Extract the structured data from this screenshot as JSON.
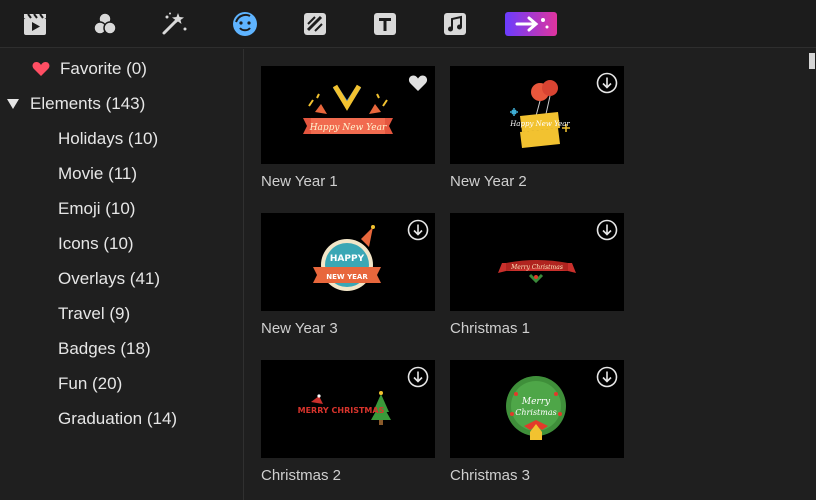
{
  "toolbar": {
    "icons": [
      "media-icon",
      "effects-icon",
      "magic-icon",
      "elements-icon",
      "transitions-icon",
      "text-icon",
      "audio-icon",
      "plugin-icon"
    ],
    "active_color": "#5fb4ff"
  },
  "sidebar": {
    "favorite": {
      "label": "Favorite (0)",
      "icon": "heart-icon",
      "color": "#ff4e63"
    },
    "elements": {
      "label": "Elements (143)",
      "icon": "triangle-down-icon"
    },
    "children": [
      {
        "label": "Holidays (10)"
      },
      {
        "label": "Movie (11)"
      },
      {
        "label": "Emoji (10)"
      },
      {
        "label": "Icons (10)"
      },
      {
        "label": "Overlays (41)"
      },
      {
        "label": "Travel (9)"
      },
      {
        "label": "Badges (18)"
      },
      {
        "label": "Fun (20)"
      },
      {
        "label": "Graduation (14)"
      }
    ]
  },
  "grid": {
    "items": [
      {
        "label": "New Year 1",
        "badge": "heart-icon",
        "art_text": "Happy New Year"
      },
      {
        "label": "New Year 2",
        "badge": "download-icon",
        "art_text": "Happy New Year"
      },
      {
        "label": "New Year 3",
        "badge": "download-icon",
        "art_text_top": "HAPPY",
        "art_text_bottom": "NEW YEAR"
      },
      {
        "label": "Christmas 1",
        "badge": "download-icon",
        "art_text": "Merry Christmas"
      },
      {
        "label": "Christmas 2",
        "badge": "download-icon",
        "art_text": "MERRY CHRISTMAS"
      },
      {
        "label": "Christmas 3",
        "badge": "download-icon",
        "art_text_top": "Merry",
        "art_text_bottom": "Christmas"
      }
    ]
  }
}
